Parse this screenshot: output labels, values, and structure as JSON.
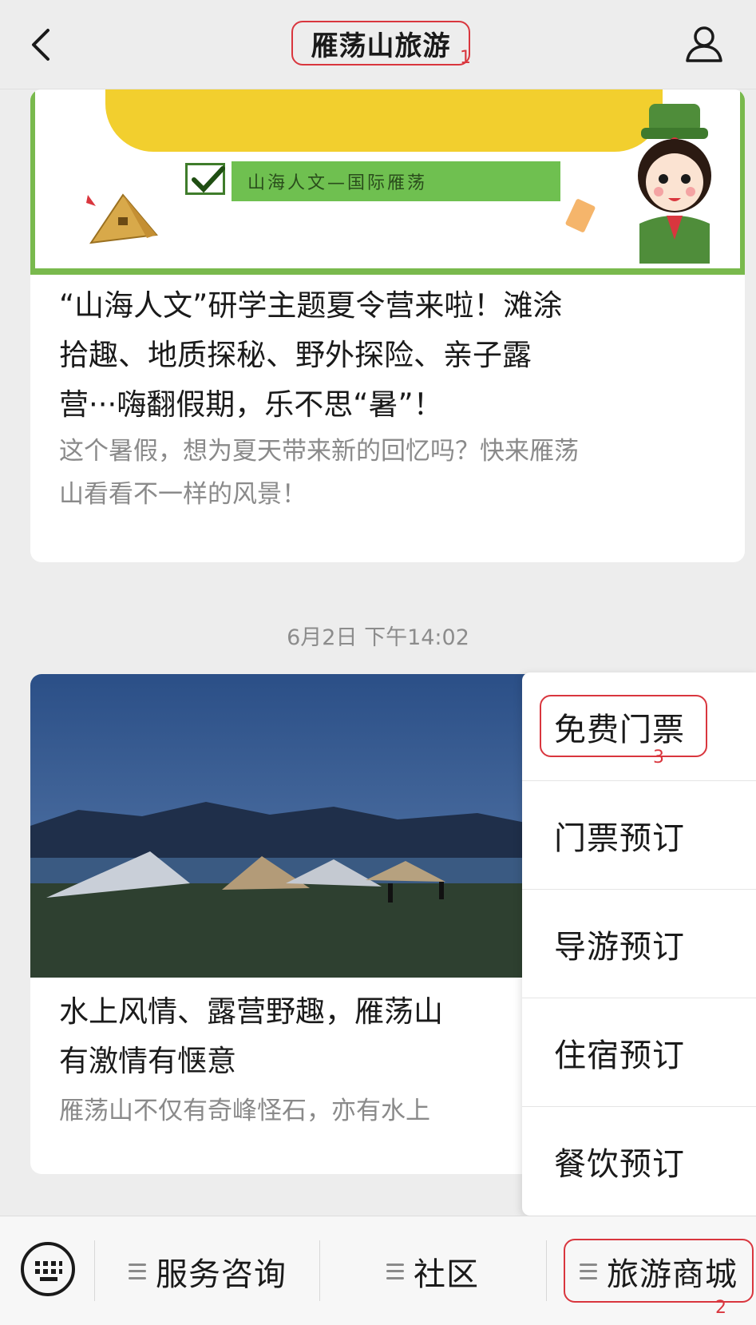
{
  "header": {
    "back_icon": "chevron-left-icon",
    "title": "雁荡山旅游",
    "profile_icon": "person-icon"
  },
  "annotations": {
    "title_marker": "1",
    "mall_marker": "2",
    "free_ticket_marker": "3",
    "highlight_color": "#d9363e"
  },
  "article1": {
    "banner": {
      "strip_text": "山海人文—国际雁荡",
      "theme_color": "#79b94d",
      "accent_color": "#f2cf2e"
    },
    "title_lines": [
      "“山海人文”研学主题夏令营来啦！滩涂",
      "拾趣、地质探秘、野外探险、亲子露",
      "营···嗨翻假期，乐不思“暑”！"
    ],
    "desc_lines": [
      "这个暑假，想为夏天带来新的回忆吗？快来雁荡",
      "山看看不一样的风景！"
    ]
  },
  "timestamp": "6月2日 下午14:02",
  "article2": {
    "title_lines": [
      "水上风情、露营野趣，雁荡山",
      "有激情有惬意"
    ],
    "desc_lines": [
      "雁荡山不仅有奇峰怪石，亦有水上"
    ]
  },
  "popup_menu": {
    "items": [
      {
        "label": "免费门票"
      },
      {
        "label": "门票预订"
      },
      {
        "label": "导游预订"
      },
      {
        "label": "住宿预订"
      },
      {
        "label": "餐饮预订"
      }
    ]
  },
  "bottom_bar": {
    "keyboard_icon": "keyboard-icon",
    "menus": [
      {
        "label": "服务咨询"
      },
      {
        "label": "社区"
      },
      {
        "label": "旅游商城"
      }
    ]
  }
}
